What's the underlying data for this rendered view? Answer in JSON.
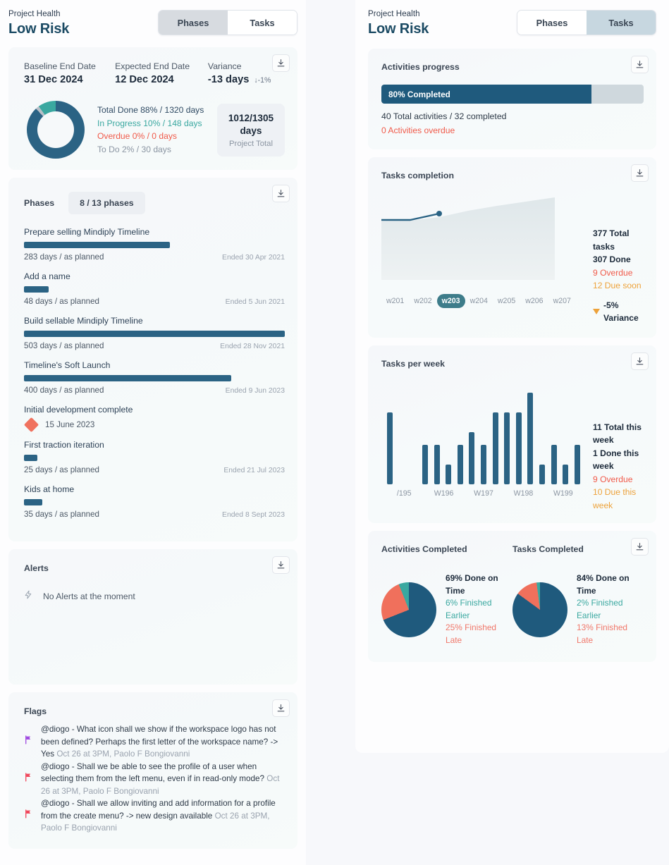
{
  "left": {
    "header": {
      "kicker": "Project Health",
      "title": "Low Risk"
    },
    "tabs": {
      "phases": "Phases",
      "tasks": "Tasks",
      "selected": "Phases"
    },
    "summary": {
      "baseline_label": "Baseline End Date",
      "baseline_value": "31 Dec 2024",
      "expected_label": "Expected End Date",
      "expected_value": "12 Dec 2024",
      "variance_label": "Variance",
      "variance_value": "-13 days",
      "variance_pct": "↓-1%",
      "legend": {
        "done": "Total Done 88% / 1320 days",
        "in_progress": "In Progress 10% / 148 days",
        "overdue": "Overdue 0% / 0 days",
        "todo": "To Do 2% / 30 days"
      },
      "total_value_line1": "1012/1305",
      "total_value_line2": "days",
      "total_sub": "Project Total"
    },
    "phases_card": {
      "title": "Phases",
      "chip": "8 / 13 phases",
      "items": [
        {
          "name": "Prepare selling Mindiply Timeline",
          "days": "283 days / as planned",
          "ended": "Ended 30 Apr 2021",
          "bar_pct": 56,
          "type": "bar"
        },
        {
          "name": "Add a name",
          "days": "48 days / as planned",
          "ended": "Ended 5 Jun 2021",
          "bar_pct": 9.5,
          "type": "bar"
        },
        {
          "name": "Build sellable Mindiply Timeline",
          "days": "503 days / as planned",
          "ended": "Ended 28 Nov 2021",
          "bar_pct": 100,
          "type": "bar"
        },
        {
          "name": "Timeline's Soft Launch",
          "days": "400 days / as planned",
          "ended": "Ended 9 Jun 2023",
          "bar_pct": 79.5,
          "type": "bar"
        },
        {
          "name": "Initial development complete",
          "milestone_date": "15 June 2023",
          "type": "milestone"
        },
        {
          "name": "First traction iteration",
          "days": "25 days / as planned",
          "ended": "Ended 21 Jul 2023",
          "bar_pct": 5,
          "type": "bar"
        },
        {
          "name": "Kids at home",
          "days": "35 days / as planned",
          "ended": "Ended 8 Sept 2023",
          "bar_pct": 7,
          "type": "bar"
        }
      ]
    },
    "alerts_card": {
      "title": "Alerts",
      "empty_text": "No Alerts at the moment"
    },
    "flags_card": {
      "title": "Flags",
      "items": [
        {
          "text": "@diogo - What icon shall we show if the workspace logo has not been defined? Perhaps the first letter of the workspace name? -> Yes",
          "meta": "Oct 26 at 3PM, Paolo F Bongiovanni",
          "color": "#a04ae0"
        },
        {
          "text": "@diogo - Shall we be able to see the profile of a user when selecting them from the left menu, even if in read-only mode?",
          "meta": "Oct 26 at 3PM, Paolo F Bongiovanni",
          "color": "#f0465a"
        },
        {
          "text": "@diogo - Shall we allow inviting and add information for a profile from the create menu? -> new design available",
          "meta": "Oct 26 at 3PM, Paolo F Bongiovanni",
          "color": "#f0465a"
        }
      ]
    }
  },
  "right": {
    "header": {
      "kicker": "Project Health",
      "title": "Low Risk"
    },
    "tabs": {
      "phases": "Phases",
      "tasks": "Tasks",
      "selected": "Tasks"
    },
    "activities_progress": {
      "title": "Activities progress",
      "bar_label": "80% Completed",
      "bar_pct": 80,
      "line1": "40 Total activities / 32 completed",
      "line2": "0 Activities overdue"
    },
    "tasks_completion": {
      "title": "Tasks completion",
      "stats": {
        "total": "377 Total tasks",
        "done": "307 Done",
        "overdue": "9 Overdue",
        "due_soon": "12 Due soon",
        "variance": "-5% Variance"
      },
      "weeks": [
        "w201",
        "w202",
        "w203",
        "w204",
        "w205",
        "w206",
        "w207"
      ],
      "selected_week": "w203"
    },
    "tasks_per_week": {
      "title": "Tasks per week",
      "stats": {
        "total": "11 Total this week",
        "done": "1 Done this week",
        "overdue": "9 Overdue",
        "due": "10 Due this week"
      },
      "week_labels": [
        "/195",
        "W196",
        "W197",
        "W198",
        "W199"
      ]
    },
    "completed": {
      "activities_title": "Activities Completed",
      "tasks_title": "Tasks Completed",
      "activities_legend": {
        "on_time": "69% Done on Time",
        "earlier": "6% Finished Earlier",
        "late": "25% Finished Late"
      },
      "tasks_legend": {
        "on_time": "84% Done on Time",
        "earlier": "2% Finished Earlier",
        "late": "13% Finished Late"
      }
    }
  },
  "chart_data": [
    {
      "type": "area",
      "title": "Tasks completion",
      "x": [
        "w201",
        "w202",
        "w203",
        "w204",
        "w205",
        "w206",
        "w207"
      ],
      "series": [
        {
          "name": "Completed",
          "values": [
            352,
            352,
            360,
            null,
            null,
            null,
            null
          ]
        },
        {
          "name": "Total",
          "values": [
            352,
            354,
            362,
            368,
            373,
            377,
            382
          ]
        }
      ],
      "annotations": [
        "377 Total tasks",
        "307 Done",
        "9 Overdue",
        "12 Due soon",
        "-5% Variance"
      ],
      "selected_point": "w203",
      "grid": false,
      "legend": "right"
    },
    {
      "type": "bar",
      "title": "Tasks per week",
      "categories": [
        "/195",
        "W196",
        "W197",
        "W198",
        "W199"
      ],
      "bar_values": [
        11,
        0,
        0,
        6,
        6,
        3,
        6,
        8,
        6,
        11,
        11,
        11,
        14,
        3,
        6,
        3,
        6
      ],
      "ylabel": "",
      "xlabel": "",
      "annotations": [
        "11 Total this week",
        "1 Done this week",
        "9 Overdue",
        "10 Due this week"
      ],
      "grid": false
    },
    {
      "type": "pie",
      "title": "Activities Completed",
      "labels": [
        "Done on Time",
        "Finished Earlier",
        "Finished Late"
      ],
      "values": [
        69,
        6,
        25
      ],
      "colors": [
        "#1f5a7d",
        "#3aa8a0",
        "#f0705c"
      ]
    },
    {
      "type": "pie",
      "title": "Tasks Completed",
      "labels": [
        "Done on Time",
        "Finished Earlier",
        "Finished Late"
      ],
      "values": [
        84,
        2,
        13
      ],
      "colors": [
        "#1f5a7d",
        "#3aa8a0",
        "#f0705c"
      ]
    },
    {
      "type": "pie",
      "title": "Project progress donut",
      "labels": [
        "Total Done",
        "In Progress",
        "Overdue",
        "To Do"
      ],
      "values": [
        88,
        10,
        0,
        2
      ],
      "colors": [
        "#2b6384",
        "#3aa8a0",
        "#f05a4a",
        "#b9c0c8"
      ]
    }
  ]
}
